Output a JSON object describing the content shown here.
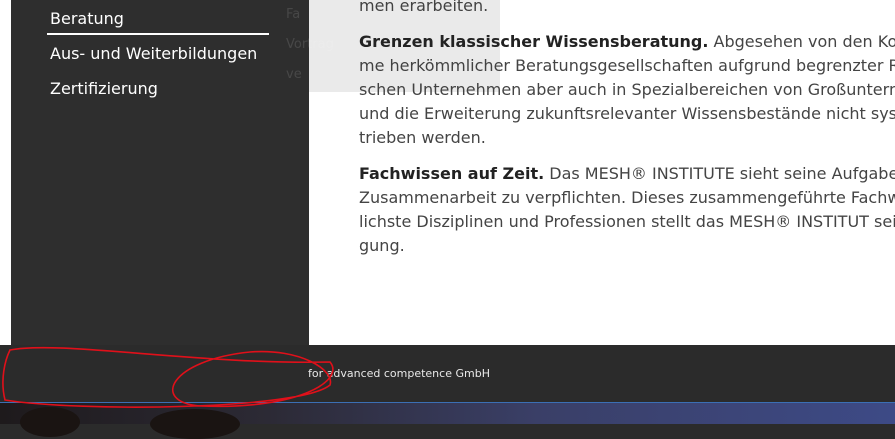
{
  "sidebar": {
    "items": [
      {
        "label": "Beratung",
        "active": true
      },
      {
        "label": "Aus- und Weiterbildungen",
        "active": false
      },
      {
        "label": "Zertifizierung",
        "active": false
      }
    ]
  },
  "overlay": {
    "lines": [
      "Fa",
      "Vortrag",
      "ve"
    ]
  },
  "content": {
    "p1_line": "men erarbeiten.",
    "p2": {
      "heading": "Grenzen klassischer Wissensberatung.",
      "first_rest": " Abgesehen von den Kosten sind",
      "lines": [
        "me herkömmlicher Beratungsgesellschaften aufgrund begrenzter Resso",
        "schen Unternehmen aber auch in Spezialbereichen von Großunternehm",
        "und die Erweiterung zukunftsrelevanter Wissensbestände nicht systema",
        "trieben werden."
      ]
    },
    "p3": {
      "heading": "Fachwissen auf Zeit.",
      "first_rest": " Das MESH® INSTITUTE sieht seine Aufgabe darin, i",
      "lines": [
        "Zusammenarbeit zu verpflichten. Dieses zusammengeführte Fachwissen",
        "lichste Disziplinen und Professionen stellt das MESH® INSTITUT seinen A",
        "gung."
      ]
    }
  },
  "footer": {
    "text": "for advanced competence GmbH"
  },
  "colors": {
    "sidebar_bg": "#2e2e2e",
    "footer_bg": "#2b2b2b",
    "annotation": "#e0101a",
    "accent_line": "#3b6fb4"
  }
}
